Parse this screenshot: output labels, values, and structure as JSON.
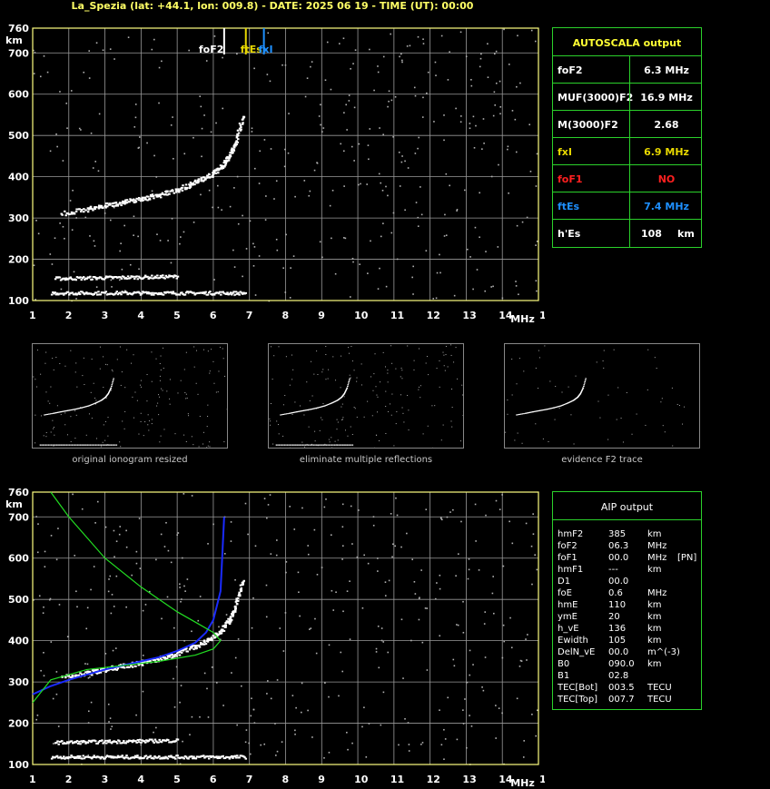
{
  "header": "La_Spezia (lat: +44.1, lon: 009.8) - DATE: 2025 06 19 - TIME (UT): 00:00",
  "thumbnails": [
    "original ionogram resized",
    "eliminate multiple reflections",
    "evidence F2 trace"
  ],
  "autoscala": {
    "title": "AUTOSCALA output",
    "rows": [
      {
        "key": "foF2",
        "value": "6.3 MHz",
        "color": "#ffffff"
      },
      {
        "key": "MUF(3000)F2",
        "value": "16.9 MHz",
        "color": "#ffffff"
      },
      {
        "key": "M(3000)F2",
        "value": "2.68",
        "color": "#ffffff"
      },
      {
        "key": "fxI",
        "value": "6.9 MHz",
        "color": "#e8d800"
      },
      {
        "key": "foF1",
        "value": "NO",
        "color": "#ff2020"
      },
      {
        "key": "ftEs",
        "value": "7.4 MHz",
        "color": "#1e90ff"
      },
      {
        "key": "h'Es",
        "value": "108",
        "unit": "km",
        "color": "#ffffff"
      }
    ]
  },
  "aip": {
    "title": "AIP output",
    "rows": [
      [
        "hmF2",
        "385",
        "km",
        ""
      ],
      [
        "foF2",
        "06.3",
        "MHz",
        ""
      ],
      [
        "foF1",
        "00.0",
        "MHz",
        "[PN]"
      ],
      [
        "hmF1",
        "---",
        "km",
        ""
      ],
      [
        "D1",
        "00.0",
        "",
        ""
      ],
      [
        "foE",
        "0.6",
        "MHz",
        ""
      ],
      [
        "hmE",
        "110",
        "km",
        ""
      ],
      [
        "ymE",
        "20",
        "km",
        ""
      ],
      [
        "h_vE",
        "136",
        "km",
        ""
      ],
      [
        "Ewidth",
        "105",
        "km",
        ""
      ],
      [
        "DelN_vE",
        "00.0",
        "m^(-3)",
        ""
      ],
      [
        "B0",
        "090.0",
        "km",
        ""
      ],
      [
        "B1",
        "02.8",
        "",
        ""
      ],
      [
        "TEC[Bot]",
        "003.5",
        "TECU",
        ""
      ],
      [
        "TEC[Top]",
        "007.7",
        "TECU",
        ""
      ]
    ]
  },
  "colors": {
    "axis": "#ffff80",
    "grid": "#9a9a9a",
    "panel": "#2bd12b",
    "profile": "#1a2bff",
    "model": "#22dd22"
  },
  "chart_data": [
    {
      "type": "scatter",
      "title": "",
      "xlabel": "MHz",
      "ylabel": "km",
      "xlim": [
        1,
        15
      ],
      "ylim": [
        100,
        760
      ],
      "xticks": [
        1,
        2,
        3,
        4,
        5,
        6,
        7,
        8,
        9,
        10,
        11,
        12,
        13,
        14,
        15
      ],
      "yticks": [
        100,
        200,
        300,
        400,
        500,
        600,
        700,
        760
      ],
      "markers": [
        {
          "label": "foF2",
          "x": 6.3,
          "color": "#ffffff"
        },
        {
          "label": "ftEs",
          "x": 6.9,
          "color": "#e8d800"
        },
        {
          "label": "fxI",
          "x": 7.4,
          "color": "#1e90ff"
        }
      ],
      "f2_trace": {
        "x": [
          1.8,
          2.5,
          3.0,
          3.5,
          4.0,
          4.5,
          5.0,
          5.5,
          5.9,
          6.2,
          6.4,
          6.6,
          6.8
        ],
        "y": [
          312,
          323,
          332,
          340,
          348,
          358,
          370,
          388,
          405,
          425,
          448,
          485,
          550
        ]
      },
      "es_trace": {
        "x": [
          1.5,
          6.9
        ],
        "y": [
          120,
          120
        ]
      },
      "es_trace2": {
        "x": [
          1.6,
          5.0
        ],
        "y": [
          155,
          160
        ]
      }
    },
    {
      "type": "line",
      "title": "",
      "xlabel": "MHz",
      "ylabel": "km",
      "xlim": [
        1,
        15
      ],
      "ylim": [
        100,
        760
      ],
      "series": [
        {
          "x": [
            1.0,
            1.5,
            2.0,
            2.5,
            3.0,
            3.5,
            4.0,
            4.5,
            5.0,
            5.5,
            5.8,
            6.0,
            6.2,
            6.3
          ],
          "y": [
            270,
            290,
            305,
            318,
            330,
            340,
            350,
            360,
            375,
            395,
            420,
            450,
            520,
            700
          ]
        },
        {
          "x": [
            1.5,
            2.0,
            3.0,
            4.0,
            5.0,
            5.6,
            6.0,
            6.2,
            6.0,
            5.5,
            4.5,
            3.5,
            2.5,
            1.5,
            1.0
          ],
          "y": [
            760,
            700,
            600,
            530,
            470,
            440,
            420,
            400,
            380,
            365,
            350,
            340,
            330,
            305,
            250
          ]
        }
      ]
    }
  ]
}
